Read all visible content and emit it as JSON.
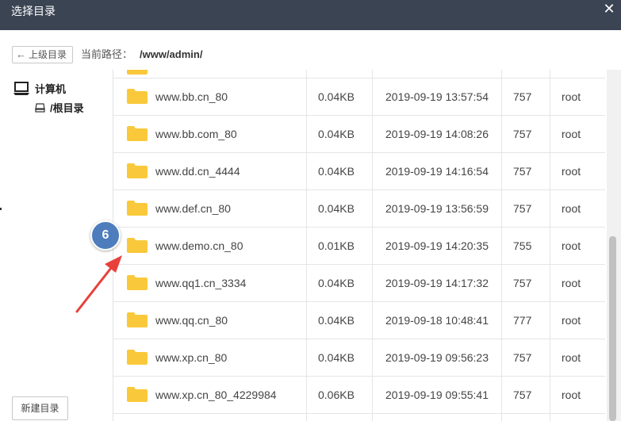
{
  "dialog": {
    "title": "选择目录",
    "close_glyph": "✕"
  },
  "toolbar": {
    "up_button_label": "上级目录",
    "up_icon": "arrow-left-icon",
    "path_label": "当前路径：",
    "path_value": "/www/admin/"
  },
  "sidebar": {
    "root_label": "计算机",
    "root_icon": "computer-icon",
    "child_label": "/根目录",
    "child_icon": "disk-icon",
    "new_folder_label": "新建目录"
  },
  "files": [
    {
      "name": "www.bb.cn_80",
      "size": "0.04KB",
      "modified": "2019-09-19 13:57:54",
      "perm": "757",
      "owner": "root"
    },
    {
      "name": "www.bb.com_80",
      "size": "0.04KB",
      "modified": "2019-09-19 14:08:26",
      "perm": "757",
      "owner": "root"
    },
    {
      "name": "www.dd.cn_4444",
      "size": "0.04KB",
      "modified": "2019-09-19 14:16:54",
      "perm": "757",
      "owner": "root"
    },
    {
      "name": "www.def.cn_80",
      "size": "0.04KB",
      "modified": "2019-09-19 13:56:59",
      "perm": "757",
      "owner": "root"
    },
    {
      "name": "www.demo.cn_80",
      "size": "0.01KB",
      "modified": "2019-09-19 14:20:35",
      "perm": "755",
      "owner": "root"
    },
    {
      "name": "www.qq1.cn_3334",
      "size": "0.04KB",
      "modified": "2019-09-19 14:17:32",
      "perm": "757",
      "owner": "root"
    },
    {
      "name": "www.qq.cn_80",
      "size": "0.04KB",
      "modified": "2019-09-18 10:48:41",
      "perm": "777",
      "owner": "root"
    },
    {
      "name": "www.xp.cn_80",
      "size": "0.04KB",
      "modified": "2019-09-19 09:56:23",
      "perm": "757",
      "owner": "root"
    },
    {
      "name": "www.xp.cn_80_4229984",
      "size": "0.06KB",
      "modified": "2019-09-19 09:55:41",
      "perm": "757",
      "owner": "root"
    }
  ],
  "annotation": {
    "badge_number": "6"
  },
  "colors": {
    "titlebar": "#3a4453",
    "folder": "#f9c93b",
    "badge": "#4e7dbd",
    "arrow": "#e8413c"
  }
}
